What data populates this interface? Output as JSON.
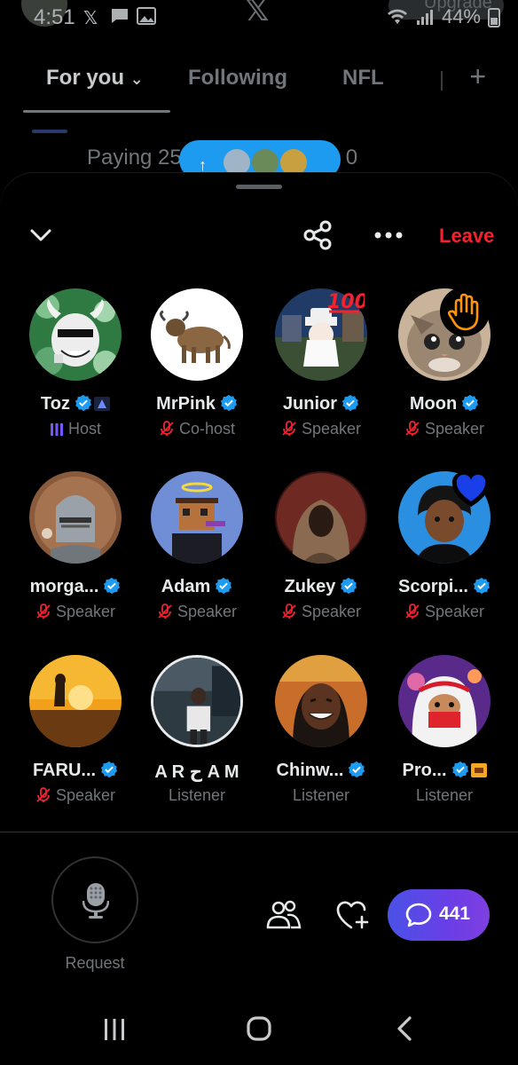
{
  "status_bar": {
    "time": "4:51",
    "battery": "44%",
    "upgrade_label": "Upgrade"
  },
  "background": {
    "tabs": [
      {
        "label": "For you",
        "active": true
      },
      {
        "label": "Following",
        "active": false
      },
      {
        "label": "NFL",
        "active": false
      }
    ],
    "tweet_text_fragment": "Paying 25",
    "tweet_text_end": "0"
  },
  "space": {
    "leave_label": "Leave",
    "participants": [
      {
        "name": "Toz",
        "role": "Host",
        "role_icon": "host-bars-icon",
        "verified": true,
        "badge": "affiliate-badge-icon"
      },
      {
        "name": "MrPink",
        "role": "Co-host",
        "role_icon": "mic-off-icon",
        "verified": true
      },
      {
        "name": "Junior",
        "role": "Speaker",
        "role_icon": "mic-off-icon",
        "verified": true,
        "reaction": "hundred-points-emoji"
      },
      {
        "name": "Moon",
        "role": "Speaker",
        "role_icon": "mic-off-icon",
        "verified": true,
        "reaction": "raised-hand-emoji"
      },
      {
        "name": "morga...",
        "role": "Speaker",
        "role_icon": "mic-off-icon",
        "verified": true
      },
      {
        "name": "Adam",
        "role": "Speaker",
        "role_icon": "mic-off-icon",
        "verified": true
      },
      {
        "name": "Zukey",
        "role": "Speaker",
        "role_icon": "mic-off-icon",
        "verified": true
      },
      {
        "name": "Scorpi...",
        "role": "Speaker",
        "role_icon": "mic-off-icon",
        "verified": true,
        "reaction": "blue-heart-emoji"
      },
      {
        "name": "FARU...",
        "role": "Speaker",
        "role_icon": "mic-off-icon",
        "verified": true
      },
      {
        "name": "A R ح A M",
        "role": "Listener",
        "verified": false
      },
      {
        "name": "Chinw...",
        "role": "Listener",
        "verified": true
      },
      {
        "name": "Pro...",
        "role": "Listener",
        "verified": true,
        "badge": "gold-badge-icon"
      }
    ],
    "request_label": "Request",
    "comments_count": "441"
  },
  "colors": {
    "accent_blue": "#1d9bf0",
    "leave_red": "#f4212e",
    "host_purple": "#7856ff",
    "mic_off_red": "#f4212e"
  }
}
